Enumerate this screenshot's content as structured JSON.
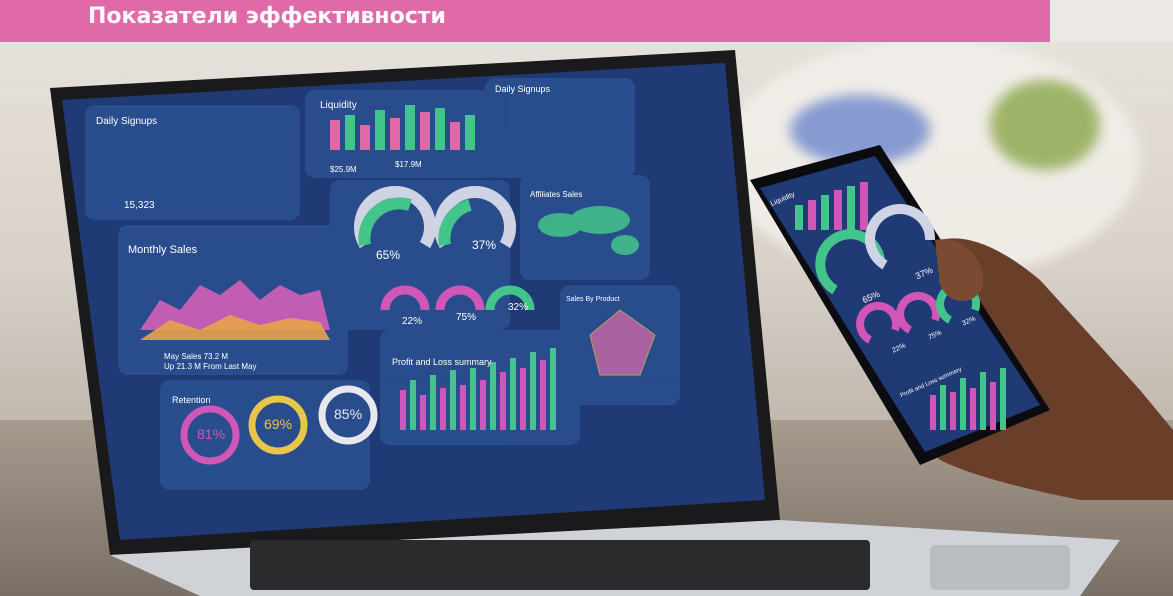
{
  "header": {
    "title": "Показатели эффективности"
  },
  "laptop_dashboard": {
    "daily_signups_left": {
      "title": "Daily Signups",
      "value": "15,323"
    },
    "liquidity": {
      "title": "Liquidity",
      "value_a": "$25.9M",
      "value_b": "$17.9M"
    },
    "daily_signups_right": {
      "title": "Daily Signups"
    },
    "monthly_sales": {
      "title": "Monthly Sales",
      "line1": "May Sales 73.2 M",
      "line2": "Up 21.3 M From Last May"
    },
    "gauges": [
      {
        "label": "65%",
        "value": 65
      },
      {
        "label": "37%",
        "value": 37
      },
      {
        "label": "22%",
        "value": 22
      },
      {
        "label": "75%",
        "value": 75
      },
      {
        "label": "32%",
        "value": 32
      }
    ],
    "affiliates": {
      "title": "Affiliates Sales"
    },
    "sales_by_product": {
      "title": "Sales By Product"
    },
    "profit_loss": {
      "title": "Profit and Loss summary"
    },
    "retention": {
      "title": "Retention",
      "rings": [
        {
          "label": "81%",
          "value": 81,
          "color": "#d056b8"
        },
        {
          "label": "69%",
          "value": 69,
          "color": "#e8c64a"
        },
        {
          "label": "85%",
          "value": 85,
          "color": "#e7e7ee"
        }
      ]
    }
  },
  "phone_dashboard": {
    "title": "Liquidity",
    "gauges": [
      {
        "label": "65%"
      },
      {
        "label": "37%"
      },
      {
        "label": "22%"
      },
      {
        "label": "75%"
      },
      {
        "label": "32%"
      }
    ],
    "profit_title": "Profit and Loss summary"
  },
  "colors": {
    "title_band": "#e06aa8",
    "screen_bg": "#1f3a75",
    "card_bg": "#2a4f8e",
    "accent_pink": "#d056b8",
    "accent_green": "#43c48a"
  }
}
